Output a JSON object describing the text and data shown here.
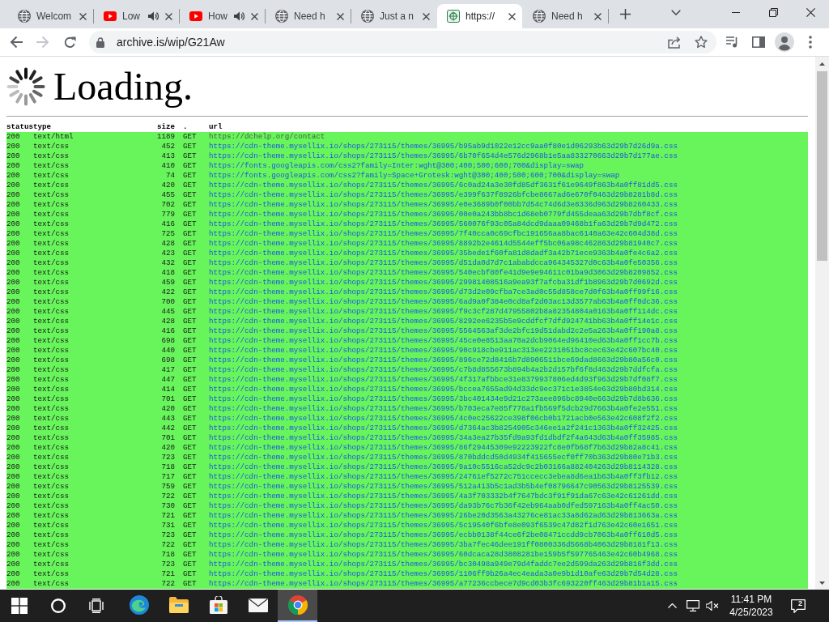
{
  "tabs": [
    {
      "title": "Welcom",
      "kind": "page",
      "audible": false,
      "selected": false
    },
    {
      "title": "Low",
      "kind": "video",
      "audible": true,
      "selected": false
    },
    {
      "title": "How",
      "kind": "video",
      "audible": true,
      "selected": false
    },
    {
      "title": "Need h",
      "kind": "page",
      "audible": false,
      "selected": false
    },
    {
      "title": "Just a n",
      "kind": "page",
      "audible": false,
      "selected": false
    },
    {
      "title": "https://",
      "kind": "archive",
      "audible": false,
      "selected": true
    },
    {
      "title": "Need h",
      "kind": "page",
      "audible": false,
      "selected": false
    }
  ],
  "address_bar": {
    "url": "archive.is/wip/G21Aw"
  },
  "page": {
    "heading": "Loading.",
    "columns": [
      "status",
      "type",
      "size",
      ".",
      "url"
    ],
    "rows": [
      {
        "status": "200",
        "type": "text/html",
        "size": "1189",
        "method": "GET",
        "url": "https://dchelp.org/contact",
        "linked": false
      },
      {
        "status": "200",
        "type": "text/css",
        "size": "452",
        "method": "GET",
        "url": "https://cdn-theme.mysellix.io/shops/273115/themes/36995/b95ab9d1022e12cc9aa0f80e1d06293b63d29b7d26d9a.css",
        "linked": true
      },
      {
        "status": "200",
        "type": "text/css",
        "size": "413",
        "method": "GET",
        "url": "https://cdn-theme.mysellix.io/shops/273115/themes/36995/6b70f654d4e576d2968b1e5aa833270663d29b7d177ae.css",
        "linked": true
      },
      {
        "status": "200",
        "type": "text/css",
        "size": "410",
        "method": "GET",
        "url": "https://fonts.googleapis.com/css2?family=Inter:wght@300;400;500;600;700&display=swap",
        "linked": true
      },
      {
        "status": "200",
        "type": "text/css",
        "size": "74",
        "method": "GET",
        "url": "https://fonts.googleapis.com/css2?family=Space+Grotesk:wght@300;400;500;600;700&display=swap",
        "linked": true
      },
      {
        "status": "200",
        "type": "text/css",
        "size": "420",
        "method": "GET",
        "url": "https://cdn-theme.mysellix.io/shops/273115/themes/36995/6c0ad24a3e30fd85df3631f61e9649f863b4a0ff81dd5.css",
        "linked": true
      },
      {
        "status": "200",
        "type": "text/css",
        "size": "455",
        "method": "GET",
        "url": "https://cdn-theme.mysellix.io/shops/273115/themes/36995/e399f637f8926bfcbe8667ad6e670f0463d29b8281b8d.css",
        "linked": true
      },
      {
        "status": "200",
        "type": "text/css",
        "size": "702",
        "method": "GET",
        "url": "https://cdn-theme.mysellix.io/shops/273115/themes/36995/e0e3689b0f00bb7d54c74d6d3e8336d963d29b8260433.css",
        "linked": true
      },
      {
        "status": "200",
        "type": "text/css",
        "size": "779",
        "method": "GET",
        "url": "https://cdn-theme.mysellix.io/shops/273115/themes/36995/00e0a243bb8bc1d68eb0779fd455deaa63d29b7dbf8cf.css",
        "linked": true
      },
      {
        "status": "200",
        "type": "text/css",
        "size": "416",
        "method": "GET",
        "url": "https://cdn-theme.mysellix.io/shops/273115/themes/36995/560076f93c05a84dcd9daaa09468b1fa63d29b7d9d472.css",
        "linked": true
      },
      {
        "status": "200",
        "type": "text/css",
        "size": "725",
        "method": "GET",
        "url": "https://cdn-theme.mysellix.io/shops/273115/themes/36995/7f40cca0c69cfbc191656aa8bac6140a63e42c604d38d.css",
        "linked": true
      },
      {
        "status": "200",
        "type": "text/css",
        "size": "428",
        "method": "GET",
        "url": "https://cdn-theme.mysellix.io/shops/273115/themes/36995/8892b2e4614d5544eff5bc06a98c462863d29b81940c7.css",
        "linked": true
      },
      {
        "status": "200",
        "type": "text/css",
        "size": "423",
        "method": "GET",
        "url": "https://cdn-theme.mysellix.io/shops/273115/themes/36995/35bede1f60fa81d8dadf3a42b71ece9363b4a0fe4c6a2.css",
        "linked": true
      },
      {
        "status": "200",
        "type": "text/css",
        "size": "432",
        "method": "GET",
        "url": "https://cdn-theme.mysellix.io/shops/273115/themes/36995/d51da0d7d7c1ababdcca964345327d0c63b4a0fe50356.css",
        "linked": true
      },
      {
        "status": "200",
        "type": "text/css",
        "size": "418",
        "method": "GET",
        "url": "https://cdn-theme.mysellix.io/shops/273115/themes/36995/540ecbf80fe41d9e9e94611c01ba9d3063d29b8209852.css",
        "linked": true
      },
      {
        "status": "200",
        "type": "text/css",
        "size": "459",
        "method": "GET",
        "url": "https://cdn-theme.mysellix.io/shops/273115/themes/36995/29981408516a9ea93f7afcba31df1b8963d29b7d0692d.css",
        "linked": true
      },
      {
        "status": "200",
        "type": "text/css",
        "size": "422",
        "method": "GET",
        "url": "https://cdn-theme.mysellix.io/shops/273115/themes/36995/d73d2e09cfba7ce3ad0c55d858ce7d0f63b4a0ff99f16.css",
        "linked": true
      },
      {
        "status": "200",
        "type": "text/css",
        "size": "700",
        "method": "GET",
        "url": "https://cdn-theme.mysellix.io/shops/273115/themes/36995/6ad9a0f384e0cd8af2d03ac13d3577ab63b4a0ff0dc36.css",
        "linked": true
      },
      {
        "status": "200",
        "type": "text/css",
        "size": "445",
        "method": "GET",
        "url": "https://cdn-theme.mysellix.io/shops/273115/themes/36995/f9c3cf287d47955802b8a82354804a0163b4a0ff114dc.css",
        "linked": true
      },
      {
        "status": "200",
        "type": "text/css",
        "size": "428",
        "method": "GET",
        "url": "https://cdn-theme.mysellix.io/shops/273115/themes/36995/8292ee6235b5e9cddfcf7dfd924741bb63b4a0ff14e1c.css",
        "linked": true
      },
      {
        "status": "200",
        "type": "text/css",
        "size": "416",
        "method": "GET",
        "url": "https://cdn-theme.mysellix.io/shops/273115/themes/36995/5564563af3de2bfc19d51dabd2c2e5a263b4a0ff190a8.css",
        "linked": true
      },
      {
        "status": "200",
        "type": "text/css",
        "size": "698",
        "method": "GET",
        "url": "https://cdn-theme.mysellix.io/shops/273115/themes/36995/45ce0e8513aa70a2dcb9064ed96410ed63b4a0ff1cc7b.css",
        "linked": true
      },
      {
        "status": "200",
        "type": "text/css",
        "size": "440",
        "method": "GET",
        "url": "https://cdn-theme.mysellix.io/shops/273115/themes/36995/90c918cbe911ac313ee2231051bc8cec63e42c607bc40.css",
        "linked": true
      },
      {
        "status": "200",
        "type": "text/css",
        "size": "698",
        "method": "GET",
        "url": "https://cdn-theme.mysellix.io/shops/273115/themes/36995/896ce72d8416b7d8906511bce69dad8663d29b80a56c0.css",
        "linked": true
      },
      {
        "status": "200",
        "type": "text/css",
        "size": "417",
        "method": "GET",
        "url": "https://cdn-theme.mysellix.io/shops/273115/themes/36995/c7b8d855673b894b4a2b2d157bf6f8d463d29b7ddfcfa.css",
        "linked": true
      },
      {
        "status": "200",
        "type": "text/css",
        "size": "447",
        "method": "GET",
        "url": "https://cdn-theme.mysellix.io/shops/273115/themes/36995/4f317afbbce31e8379937806ed4d93f963d29b7df08f7.css",
        "linked": true
      },
      {
        "status": "200",
        "type": "text/css",
        "size": "414",
        "method": "GET",
        "url": "https://cdn-theme.mysellix.io/shops/273115/themes/36995/bccea7655ad94d33dc9ec371c1e3854e63d29b80bd314.css",
        "linked": true
      },
      {
        "status": "200",
        "type": "text/css",
        "size": "701",
        "method": "GET",
        "url": "https://cdn-theme.mysellix.io/shops/273115/themes/36995/3bc401434e9d21c273aee896bc8940e663d29b7d8b636.css",
        "linked": true
      },
      {
        "status": "200",
        "type": "text/css",
        "size": "420",
        "method": "GET",
        "url": "https://cdn-theme.mysellix.io/shops/273115/themes/36995/b703eca7e85f778a1fb569f5dcb29d7663b4a0fe2e551.css",
        "linked": true
      },
      {
        "status": "200",
        "type": "text/css",
        "size": "443",
        "method": "GET",
        "url": "https://cdn-theme.mysellix.io/shops/273115/themes/36995/4c0ec25622ce398f06cb0b1721acb0e563e42c608f2f2.css",
        "linked": true
      },
      {
        "status": "200",
        "type": "text/css",
        "size": "442",
        "method": "GET",
        "url": "https://cdn-theme.mysellix.io/shops/273115/themes/36995/d7364ac3b8254905c346ee1a2f241c1363b4a0ff32425.css",
        "linked": true
      },
      {
        "status": "200",
        "type": "text/css",
        "size": "701",
        "method": "GET",
        "url": "https://cdn-theme.mysellix.io/shops/273115/themes/36995/34a3ea27b35fd9a93fd1dbdf2f4a643d63b4a0ff35985.css",
        "linked": true
      },
      {
        "status": "200",
        "type": "text/css",
        "size": "420",
        "method": "GET",
        "url": "https://cdn-theme.mysellix.io/shops/273115/themes/36995/86f29445309e92223922fc8e0fb68f7b63d29b82a8c41.css",
        "linked": true
      },
      {
        "status": "200",
        "type": "text/css",
        "size": "723",
        "method": "GET",
        "url": "https://cdn-theme.mysellix.io/shops/273115/themes/36995/870bddcd50d4934f415655ecf0ff70b363d29b80e71b3.css",
        "linked": true
      },
      {
        "status": "200",
        "type": "text/css",
        "size": "718",
        "method": "GET",
        "url": "https://cdn-theme.mysellix.io/shops/273115/themes/36995/9a10c5516ca52dc9c2b03166a882404263d29b8114328.css",
        "linked": true
      },
      {
        "status": "200",
        "type": "text/css",
        "size": "717",
        "method": "GET",
        "url": "https://cdn-theme.mysellix.io/shops/273115/themes/36995/24761ef5272c751ccecc3ebea8d6ea1b63b4a0ff3fb12.css",
        "linked": true
      },
      {
        "status": "200",
        "type": "text/css",
        "size": "759",
        "method": "GET",
        "url": "https://cdn-theme.mysellix.io/shops/273115/themes/36995/512a413b5c1ad3b5b4ef08796647c90563d29b8125539.css",
        "linked": true
      },
      {
        "status": "200",
        "type": "text/css",
        "size": "722",
        "method": "GET",
        "url": "https://cdn-theme.mysellix.io/shops/273115/themes/36995/4a3f703332b4f7647bdc3f91f91da67c63e42c61261dd.css",
        "linked": true
      },
      {
        "status": "200",
        "type": "text/css",
        "size": "730",
        "method": "GET",
        "url": "https://cdn-theme.mysellix.io/shops/273115/themes/36995/da93b76c7b36f42eb964aab0dfed597163b4a0ff4ac50.css",
        "linked": true
      },
      {
        "status": "200",
        "type": "text/css",
        "size": "721",
        "method": "GET",
        "url": "https://cdn-theme.mysellix.io/shops/273115/themes/36995/26be20d3563a43276ce81ac33a8d62ad63d29b813663a.css",
        "linked": true
      },
      {
        "status": "200",
        "type": "text/css",
        "size": "731",
        "method": "GET",
        "url": "https://cdn-theme.mysellix.io/shops/273115/themes/36995/5c19540f6bfe8e093f6539c47d82f1d763e42c60e1651.css",
        "linked": true
      },
      {
        "status": "200",
        "type": "text/css",
        "size": "723",
        "method": "GET",
        "url": "https://cdn-theme.mysellix.io/shops/273115/themes/36995/ecbb0138f44ce6f2be08471ccdd9cb7063b4a0ff610d5.css",
        "linked": true
      },
      {
        "status": "200",
        "type": "text/css",
        "size": "722",
        "method": "GET",
        "url": "https://cdn-theme.mysellix.io/shops/273115/themes/36995/3ba7fec46dee191ff0800336d5668b4063d29b8181f13.css",
        "linked": true
      },
      {
        "status": "200",
        "type": "text/css",
        "size": "718",
        "method": "GET",
        "url": "https://cdn-theme.mysellix.io/shops/273115/themes/36995/60dcaca28d3808281be159b5f597765463e42c60b4968.css",
        "linked": true
      },
      {
        "status": "200",
        "type": "text/css",
        "size": "723",
        "method": "GET",
        "url": "https://cdn-theme.mysellix.io/shops/273115/themes/36995/bc30498a949e79d4faddc7ee2d599da263d29b816f3dd.css",
        "linked": true
      },
      {
        "status": "200",
        "type": "text/css",
        "size": "721",
        "method": "GET",
        "url": "https://cdn-theme.mysellix.io/shops/273115/themes/36995/1106ff9b26a4ec4eada3a0e9b1d10afe63d29b7d54d28.css",
        "linked": true
      },
      {
        "status": "200",
        "type": "text/css",
        "size": "722",
        "method": "GET",
        "url": "https://cdn-theme.mysellix.io/shops/273115/themes/36995/a77236ccbece7d9cd03b3fc693220ff463d29b81b1a15.css",
        "linked": true
      }
    ]
  },
  "taskbar": {
    "apps": [
      {
        "kind": "swirl",
        "selected": false
      },
      {
        "kind": "folder",
        "selected": false
      },
      {
        "kind": "bag",
        "selected": false
      },
      {
        "kind": "envelope",
        "selected": false
      },
      {
        "kind": "ring",
        "selected": true
      }
    ],
    "time": "11:41 PM",
    "date": "4/25/2023",
    "notification_count": "2"
  }
}
